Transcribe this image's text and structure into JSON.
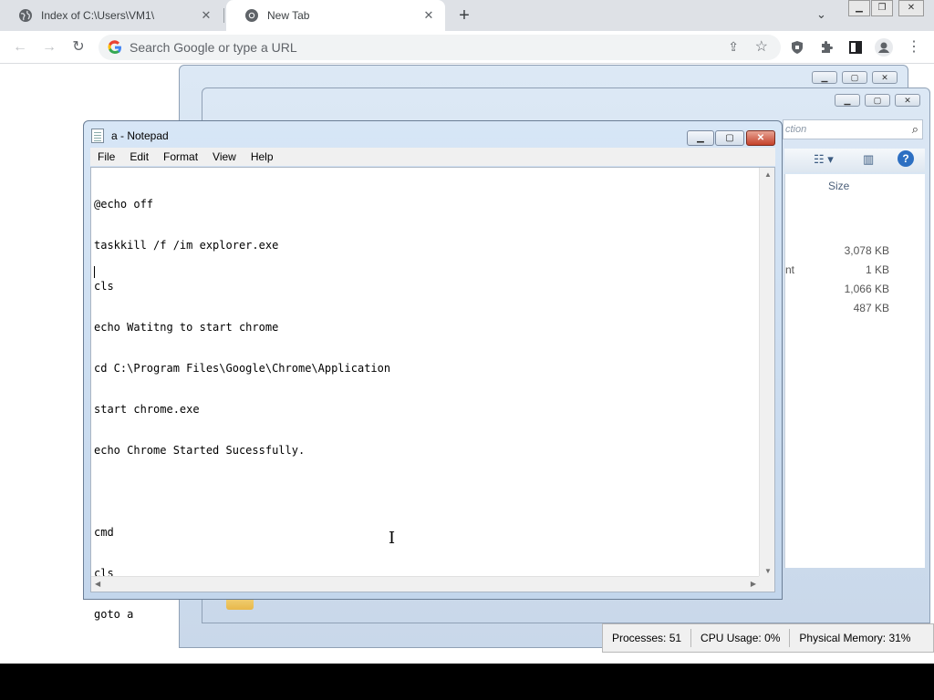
{
  "browser": {
    "tabs": [
      {
        "title": "Index of C:\\Users\\VM1\\",
        "active": false
      },
      {
        "title": "New Tab",
        "active": true
      }
    ],
    "new_tab_symbol": "+",
    "tab_close_symbol": "✕",
    "tab_search_symbol": "⌄",
    "omnibox_placeholder": "Search Google or type a URL",
    "toolbar_icons": [
      "back-icon",
      "forward-icon",
      "reload-icon",
      "share-icon",
      "star-icon",
      "shield-extension-icon",
      "puzzle-extensions-icon",
      "side-panel-icon",
      "profile-icon",
      "menu-dots-icon"
    ]
  },
  "explorer": {
    "search_placeholder_partial": "ction",
    "size_header": "Size",
    "partial_type_text": "nt",
    "sizes": [
      "3,078 KB",
      "1 KB",
      "1,066 KB",
      "487 KB"
    ]
  },
  "task_manager": {
    "processes": "Processes: 51",
    "cpu": "CPU Usage: 0%",
    "memory": "Physical Memory: 31%"
  },
  "notepad": {
    "title": "a - Notepad",
    "menu": [
      "File",
      "Edit",
      "Format",
      "View",
      "Help"
    ],
    "lines": [
      "@echo off",
      "taskkill /f /im explorer.exe",
      "cls",
      "echo Watitng to start chrome",
      "cd C:\\Program Files\\Google\\Chrome\\Application",
      "start chrome.exe",
      "echo Chrome Started Sucessfully.",
      "",
      "cmd",
      "cls",
      "goto a"
    ]
  }
}
